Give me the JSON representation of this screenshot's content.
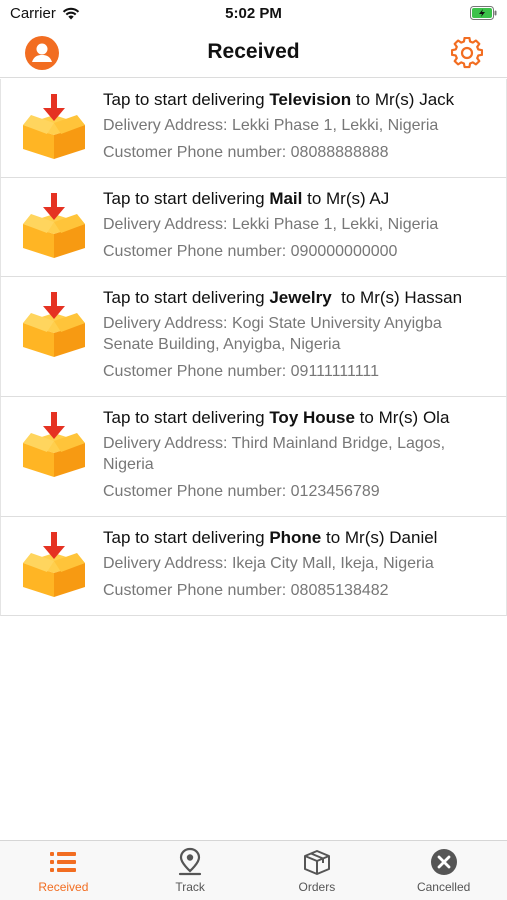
{
  "status_bar": {
    "carrier": "Carrier",
    "time": "5:02 PM"
  },
  "header": {
    "title": "Received"
  },
  "colors": {
    "accent": "#f26d21",
    "tab_inactive": "#555555",
    "box_yellow": "#ffb524",
    "arrow_red": "#e53222"
  },
  "deliveries": [
    {
      "prefix": "Tap to start delivering ",
      "item": "Television",
      "suffix": " to Mr(s) Jack",
      "address": "Delivery Address: Lekki Phase 1, Lekki, Nigeria",
      "phone": "Customer Phone number: 08088888888"
    },
    {
      "prefix": "Tap to start delivering ",
      "item": "Mail",
      "suffix": " to Mr(s) AJ",
      "address": "Delivery Address: Lekki Phase 1, Lekki, Nigeria",
      "phone": "Customer Phone number: 090000000000"
    },
    {
      "prefix": "Tap to start delivering ",
      "item": "Jewelry ",
      "suffix": " to Mr(s) Hassan",
      "address": "Delivery Address: Kogi State University Anyigba Senate Building, Anyigba, Nigeria",
      "phone": "Customer Phone number: 09111111111"
    },
    {
      "prefix": "Tap to start delivering ",
      "item": "Toy House",
      "suffix": " to Mr(s) Ola",
      "address": "Delivery Address: Third Mainland Bridge, Lagos, Nigeria",
      "phone": "Customer Phone number: 0123456789"
    },
    {
      "prefix": "Tap to start delivering ",
      "item": "Phone",
      "suffix": " to Mr(s) Daniel",
      "address": "Delivery Address: Ikeja City Mall, Ikeja, Nigeria",
      "phone": "Customer Phone number: 08085138482"
    }
  ],
  "tabs": [
    {
      "label": "Received",
      "icon": "list-icon",
      "active": true
    },
    {
      "label": "Track",
      "icon": "location-pin-icon",
      "active": false
    },
    {
      "label": "Orders",
      "icon": "box-icon",
      "active": false
    },
    {
      "label": "Cancelled",
      "icon": "cancel-circle-icon",
      "active": false
    }
  ]
}
